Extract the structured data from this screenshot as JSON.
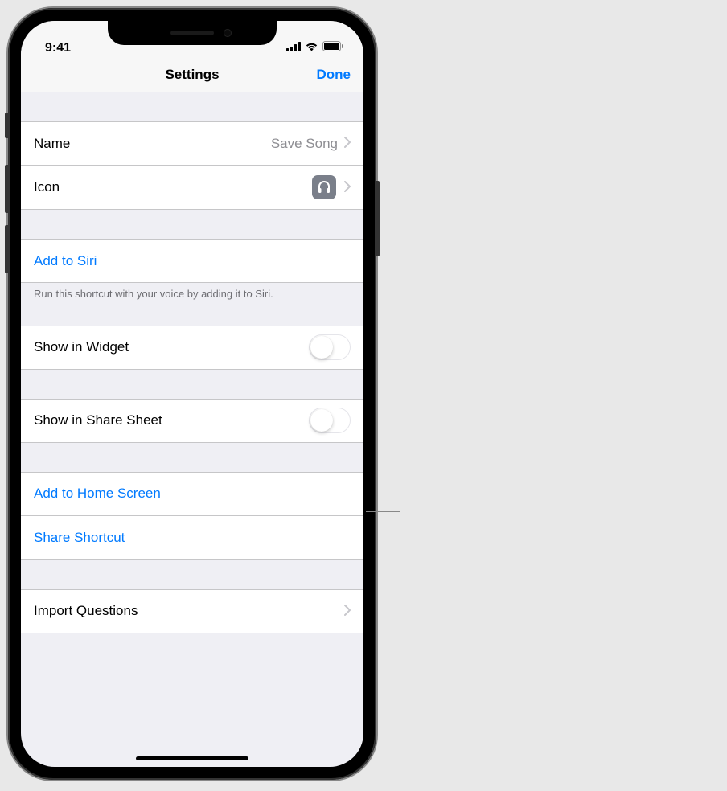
{
  "status": {
    "time": "9:41"
  },
  "nav": {
    "title": "Settings",
    "done": "Done"
  },
  "general": {
    "name_label": "Name",
    "name_value": "Save Song",
    "icon_label": "Icon"
  },
  "siri": {
    "add_label": "Add to Siri",
    "footer": "Run this shortcut with your voice by adding it to Siri."
  },
  "widget": {
    "label": "Show in Widget"
  },
  "share_sheet": {
    "label": "Show in Share Sheet"
  },
  "actions": {
    "home_screen": "Add to Home Screen",
    "share": "Share Shortcut"
  },
  "import": {
    "label": "Import Questions"
  }
}
